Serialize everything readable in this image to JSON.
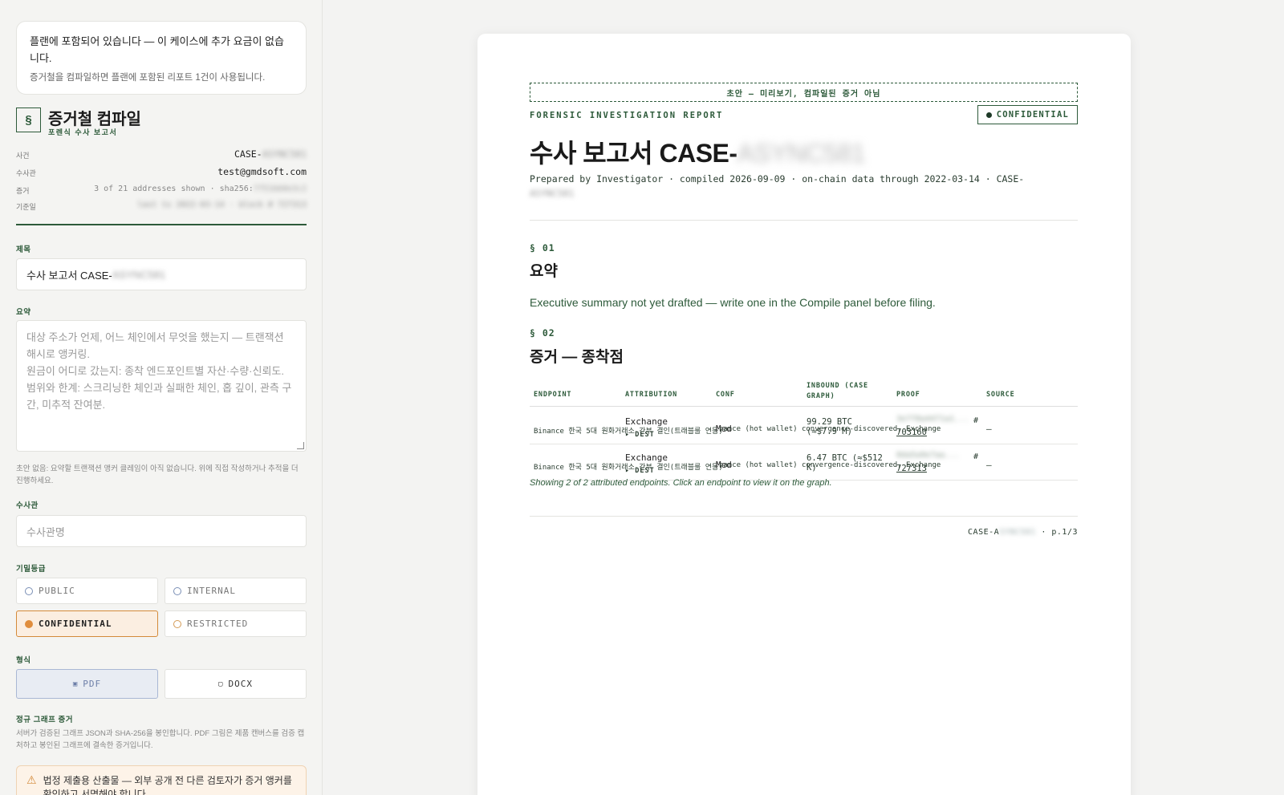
{
  "plan_card": {
    "line1": "플랜에 포함되어 있습니다 — 이 케이스에 추가 요금이 없습니다.",
    "line2": "증거철을 컴파일하면 플랜에 포함된 리포트 1건이 사용됩니다."
  },
  "compile": {
    "icon": "§",
    "title": "증거철 컴파일",
    "subtitle": "포렌식 수사 보고서"
  },
  "meta": [
    {
      "key": "사건",
      "value": "CASE-",
      "blurred": "ASYNC581"
    },
    {
      "key": "수사관",
      "value": "test@gmdsoft.com",
      "blurred": ""
    },
    {
      "key": "증거",
      "value": "3 of 21 addresses shown · sha256:",
      "blurred": "7f51bb0e3c2"
    },
    {
      "key": "기준일",
      "value": "",
      "blurred": "last tx 2022-03-14 · block # 727313"
    }
  ],
  "form": {
    "title_label": "제목",
    "title_value": "수사 보고서 CASE-",
    "title_blur": "ASYNC581",
    "summary_label": "요약",
    "summary_placeholder": "대상 주소가 언제, 어느 체인에서 무엇을 했는지 — 트랜잭션 해시로 앵커링.\n원금이 어디로 갔는지: 종착 엔드포인트별 자산·수량·신뢰도.\n범위와 한계: 스크리닝한 체인과 실패한 체인, 홉 깊이, 관측 구간, 미추적 잔여분.",
    "summary_hint": "초안 없음: 요약할 트랜잭션 앵커 클레임이 아직 없습니다. 위에 직접 작성하거나 추적을 더 진행하세요.",
    "investigator_label": "수사관",
    "investigator_placeholder": "수사관명",
    "classification_label": "기밀등급",
    "classifications": [
      "PUBLIC",
      "INTERNAL",
      "CONFIDENTIAL",
      "RESTRICTED"
    ],
    "classification_selected": "CONFIDENTIAL",
    "format_label": "형식",
    "format_pdf": "PDF",
    "format_docx": "DOCX",
    "graph_label": "정규 그래프 증거",
    "graph_hint": "서버가 검증된 그래프 JSON과 SHA-256을 봉인합니다. PDF 그림은 제품 캔버스를 검증 캡처하고 봉인된 그래프에 결속한 증거입니다.",
    "warning": "법정 제출용 산출물 — 외부 공개 전 다른 검토자가 증거 앵커를 확인하고 서명해야 합니다."
  },
  "report": {
    "draft_banner": "초안 — 미리보기, 컴파일된 증거 아님",
    "kicker": "FORENSIC INVESTIGATION REPORT",
    "confidential": "CONFIDENTIAL",
    "title": "수사 보고서 CASE-",
    "title_blur": "ASYNC581",
    "prepared": "Prepared by Investigator · compiled 2026-09-09 · on-chain data through 2022-03-14 · CASE-",
    "prepared_blur": "ASYNC581",
    "s1_no": "§ 01",
    "s1_title": "요약",
    "s1_body": "Executive summary not yet drafted — write one in the Compile panel before filing.",
    "s2_no": "§ 02",
    "s2_title": "증거 — 종착점",
    "columns": [
      "ENDPOINT",
      "ATTRIBUTION",
      "CONF",
      "INBOUND (CASE GRAPH)",
      "PROOF",
      "SOURCE"
    ],
    "rows": [
      {
        "endpoint": "Binance 한국 5대 원화거래소 간부 결인(트래블룰 연동)",
        "attribution": "Exchange",
        "dest": "▸ DEST",
        "conf": "Med",
        "conf_source": "nance (hot wallet) convergence-discovered, Exchange",
        "inbound": "99.29 BTC (≈$7.9 M)",
        "proof": "3e7f8a4471a1...",
        "proof_block": "703160",
        "hash": "#",
        "source": "—"
      },
      {
        "endpoint": "Binance 한국 5대 원화거래소 간부 결인(트래블룰 연동)",
        "attribution": "Exchange",
        "dest": "▸ DEST",
        "conf": "Med",
        "conf_source": "nance (hot wallet) convergence-discovered, Exchange",
        "inbound": "6.47 BTC (≈$512 K)",
        "proof": "8da5a9e7aa...",
        "proof_block": "727313",
        "hash": "#",
        "source": "—"
      }
    ],
    "showing": "Showing 2 of 2 attributed endpoints. Click an endpoint to view it on the graph.",
    "footer_case": "CASE-A",
    "footer_blur": "SYNC581",
    "footer_page": "· p.1/3"
  }
}
